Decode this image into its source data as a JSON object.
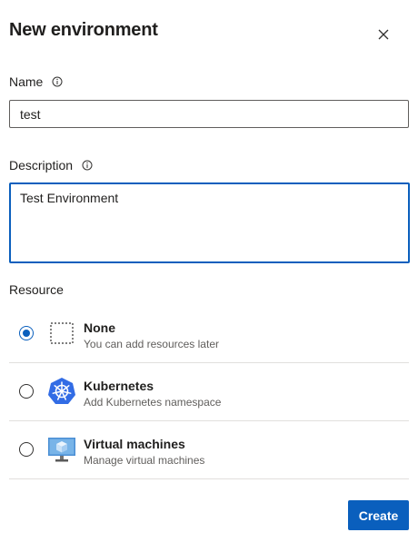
{
  "dialog": {
    "title": "New environment",
    "close_icon": "close-icon"
  },
  "name": {
    "label": "Name",
    "info_icon": "info-icon",
    "value": "test"
  },
  "description": {
    "label": "Description",
    "info_icon": "info-icon",
    "value": "Test Environment"
  },
  "resource": {
    "label": "Resource",
    "selected": "None",
    "options": [
      {
        "title": "None",
        "subtitle": "You can add resources later",
        "icon": "dotted-square-icon",
        "checked": true
      },
      {
        "title": "Kubernetes",
        "subtitle": "Add Kubernetes namespace",
        "icon": "kubernetes-icon",
        "checked": false
      },
      {
        "title": "Virtual machines",
        "subtitle": "Manage virtual machines",
        "icon": "virtual-machine-icon",
        "checked": false
      }
    ]
  },
  "actions": {
    "create_label": "Create"
  },
  "colors": {
    "accent": "#0a5fbd",
    "kubernetes": "#326ce5",
    "vm_screen": "#5a9bd5"
  }
}
